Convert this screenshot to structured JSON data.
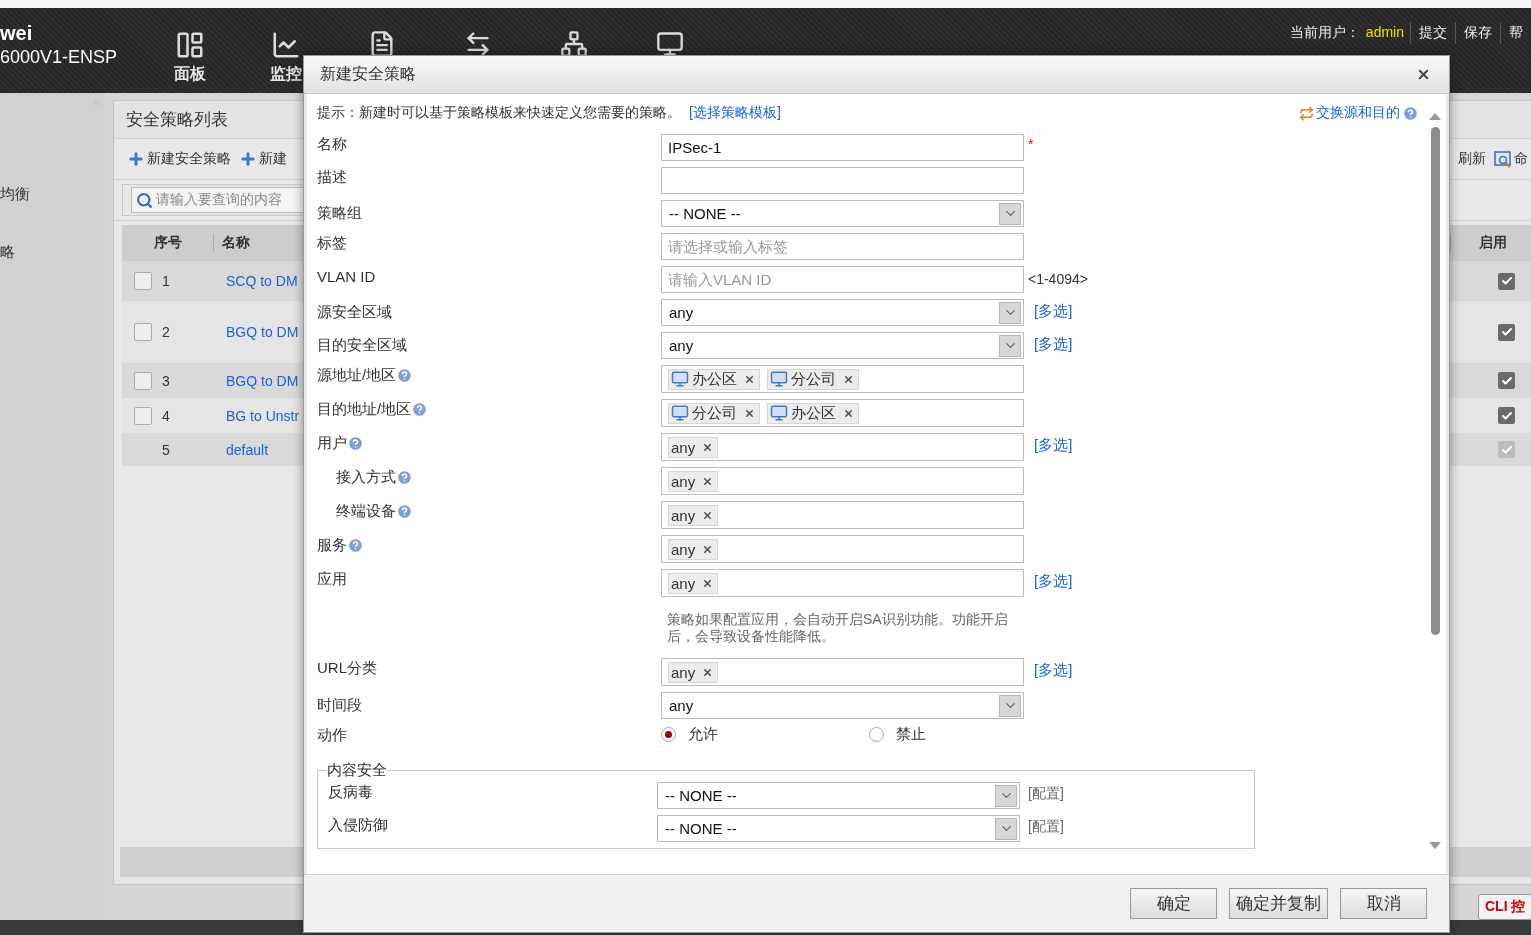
{
  "header": {
    "brand": [
      "wei",
      "6000V1-ENSP"
    ],
    "nav": [
      {
        "label": "面板"
      },
      {
        "label": "监控"
      }
    ],
    "user_label": "当前用户：",
    "user": "admin",
    "actions": [
      "提交",
      "保存",
      "帮"
    ]
  },
  "sidebar": {
    "items": [
      "均衡",
      "略"
    ]
  },
  "panel": {
    "title": "安全策略列表",
    "actions": [
      "新建安全策略",
      "新建"
    ],
    "right_actions": [
      "刷新",
      "命"
    ],
    "search": {
      "placeholder": "请输入要查询的内容"
    },
    "columns": [
      "序号",
      "名称"
    ],
    "right_column": "启用",
    "rows": [
      {
        "kind": "policy",
        "number": "1",
        "name": "SCQ to DM",
        "checked": false,
        "enabled": true
      },
      {
        "kind": "policy",
        "number": "2",
        "name": "BGQ to DM",
        "checked": false,
        "enabled": true
      },
      {
        "kind": "policy",
        "number": "3",
        "name": "BGQ to DM",
        "checked": false,
        "enabled": true
      },
      {
        "kind": "policy",
        "number": "4",
        "name": "BG to Unstr",
        "checked": false,
        "enabled": true
      },
      {
        "kind": "default",
        "number": "5",
        "name": "default",
        "enabled": true
      }
    ]
  },
  "dialog": {
    "title": "新建安全策略",
    "hint": "提示：新建时可以基于策略模板来快速定义您需要的策略。",
    "hint_link": "[选择策略模板]",
    "swap_link": "交换源和目的",
    "fields": [
      {
        "kind": "text",
        "label": "名称",
        "value": "IPSec-1",
        "required_mark": "*"
      },
      {
        "kind": "text",
        "label": "描述"
      },
      {
        "kind": "select",
        "label": "策略组",
        "value": "-- NONE --"
      },
      {
        "kind": "text",
        "label": "标签",
        "placeholder": "请选择或输入标签"
      },
      {
        "kind": "text",
        "label": "VLAN ID",
        "placeholder": "请输入VLAN ID",
        "suffix": "<1-4094>"
      },
      {
        "kind": "select",
        "label": "源安全区域",
        "value": "any",
        "link": "[多选]"
      },
      {
        "kind": "select",
        "label": "目的安全区域",
        "value": "any",
        "link": "[多选]"
      },
      {
        "kind": "tags",
        "label": "源地址/地区",
        "help": true,
        "tags": [
          {
            "kind": "address",
            "label": "办公区"
          },
          {
            "kind": "address",
            "label": "分公司"
          }
        ]
      },
      {
        "kind": "tags",
        "label": "目的地址/地区",
        "help": true,
        "tags": [
          {
            "kind": "address",
            "label": "分公司"
          },
          {
            "kind": "address",
            "label": "办公区"
          }
        ]
      },
      {
        "kind": "tags",
        "label": "用户",
        "help": true,
        "tags": [
          {
            "kind": "plain",
            "label": "any"
          }
        ],
        "link": "[多选]"
      },
      {
        "kind": "tags",
        "label": "接入方式",
        "help": true,
        "indent": true,
        "tags": [
          {
            "kind": "plain",
            "label": "any"
          }
        ]
      },
      {
        "kind": "tags",
        "label": "终端设备",
        "help": true,
        "indent": true,
        "tags": [
          {
            "kind": "plain",
            "label": "any"
          }
        ]
      },
      {
        "kind": "tags",
        "label": "服务",
        "help": true,
        "tags": [
          {
            "kind": "plain",
            "label": "any"
          }
        ]
      },
      {
        "kind": "tags",
        "label": "应用",
        "tags": [
          {
            "kind": "plain",
            "label": "any"
          }
        ],
        "link": "[多选]"
      },
      {
        "kind": "note",
        "text": "策略如果配置应用，会自动开启SA识别功能。功能开启后，会导致设备性能降低。"
      },
      {
        "kind": "tags",
        "label": "URL分类",
        "tags": [
          {
            "kind": "plain",
            "label": "any"
          }
        ],
        "link": "[多选]"
      },
      {
        "kind": "select",
        "label": "时间段",
        "value": "any"
      },
      {
        "kind": "radio",
        "label": "动作",
        "options": [
          {
            "label": "允许",
            "selected": true
          },
          {
            "label": "禁止",
            "selected": false
          }
        ]
      }
    ],
    "content_security": {
      "legend": "内容安全",
      "rows": [
        {
          "label": "反病毒",
          "value": "-- NONE --",
          "link": "[配置]"
        },
        {
          "label": "入侵防御",
          "value": "-- NONE --",
          "link": "[配置]"
        }
      ]
    },
    "buttons": [
      "确定",
      "确定并复制",
      "取消"
    ]
  },
  "cli_button": "CLI 控"
}
